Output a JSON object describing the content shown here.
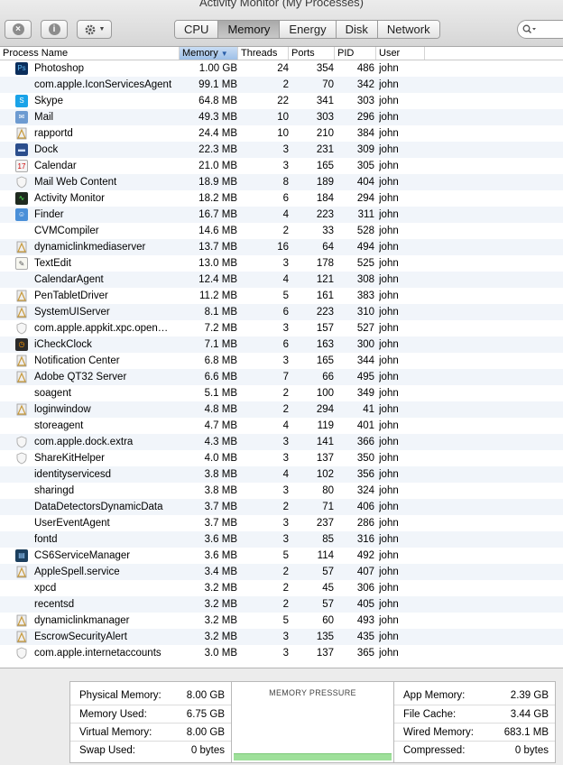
{
  "window": {
    "title": "Activity Monitor (My Processes)"
  },
  "toolbar": {
    "stop_icon": "x-circle-icon",
    "info_icon": "info-circle-icon",
    "gear_icon": "gear-icon",
    "tabs": [
      {
        "label": "CPU",
        "active": false
      },
      {
        "label": "Memory",
        "active": true
      },
      {
        "label": "Energy",
        "active": false
      },
      {
        "label": "Disk",
        "active": false
      },
      {
        "label": "Network",
        "active": false
      }
    ],
    "search_icon": "magnifier-icon"
  },
  "table": {
    "columns": {
      "name": "Process Name",
      "memory": "Memory",
      "threads": "Threads",
      "ports": "Ports",
      "pid": "PID",
      "user": "User"
    },
    "sorted_column": "Memory",
    "rows": [
      {
        "name": "Photoshop",
        "memory": "1.00 GB",
        "threads": "24",
        "ports": "354",
        "pid": "486",
        "user": "john",
        "icon": "photoshop-icon"
      },
      {
        "name": "com.apple.IconServicesAgent",
        "memory": "99.1 MB",
        "threads": "2",
        "ports": "70",
        "pid": "342",
        "user": "john",
        "icon": ""
      },
      {
        "name": "Skype",
        "memory": "64.8 MB",
        "threads": "22",
        "ports": "341",
        "pid": "303",
        "user": "john",
        "icon": "skype-icon"
      },
      {
        "name": "Mail",
        "memory": "49.3 MB",
        "threads": "10",
        "ports": "303",
        "pid": "296",
        "user": "john",
        "icon": "mail-icon"
      },
      {
        "name": "rapportd",
        "memory": "24.4 MB",
        "threads": "10",
        "ports": "210",
        "pid": "384",
        "user": "john",
        "icon": "exec-icon"
      },
      {
        "name": "Dock",
        "memory": "22.3 MB",
        "threads": "3",
        "ports": "231",
        "pid": "309",
        "user": "john",
        "icon": "dock-icon"
      },
      {
        "name": "Calendar",
        "memory": "21.0 MB",
        "threads": "3",
        "ports": "165",
        "pid": "305",
        "user": "john",
        "icon": "calendar-icon"
      },
      {
        "name": "Mail Web Content",
        "memory": "18.9 MB",
        "threads": "8",
        "ports": "189",
        "pid": "404",
        "user": "john",
        "icon": "shield-icon"
      },
      {
        "name": "Activity Monitor",
        "memory": "18.2 MB",
        "threads": "6",
        "ports": "184",
        "pid": "294",
        "user": "john",
        "icon": "activity-monitor-icon"
      },
      {
        "name": "Finder",
        "memory": "16.7 MB",
        "threads": "4",
        "ports": "223",
        "pid": "311",
        "user": "john",
        "icon": "finder-icon"
      },
      {
        "name": "CVMCompiler",
        "memory": "14.6 MB",
        "threads": "2",
        "ports": "33",
        "pid": "528",
        "user": "john",
        "icon": ""
      },
      {
        "name": "dynamiclinkmediaserver",
        "memory": "13.7 MB",
        "threads": "16",
        "ports": "64",
        "pid": "494",
        "user": "john",
        "icon": "exec-icon"
      },
      {
        "name": "TextEdit",
        "memory": "13.0 MB",
        "threads": "3",
        "ports": "178",
        "pid": "525",
        "user": "john",
        "icon": "textedit-icon"
      },
      {
        "name": "CalendarAgent",
        "memory": "12.4 MB",
        "threads": "4",
        "ports": "121",
        "pid": "308",
        "user": "john",
        "icon": ""
      },
      {
        "name": "PenTabletDriver",
        "memory": "11.2 MB",
        "threads": "5",
        "ports": "161",
        "pid": "383",
        "user": "john",
        "icon": "exec-icon"
      },
      {
        "name": "SystemUIServer",
        "memory": "8.1 MB",
        "threads": "6",
        "ports": "223",
        "pid": "310",
        "user": "john",
        "icon": "exec-icon"
      },
      {
        "name": "com.apple.appkit.xpc.open…",
        "memory": "7.2 MB",
        "threads": "3",
        "ports": "157",
        "pid": "527",
        "user": "john",
        "icon": "shield-icon"
      },
      {
        "name": "iCheckClock",
        "memory": "7.1 MB",
        "threads": "6",
        "ports": "163",
        "pid": "300",
        "user": "john",
        "icon": "clock-app-icon"
      },
      {
        "name": "Notification Center",
        "memory": "6.8 MB",
        "threads": "3",
        "ports": "165",
        "pid": "344",
        "user": "john",
        "icon": "exec-icon"
      },
      {
        "name": "Adobe QT32 Server",
        "memory": "6.6 MB",
        "threads": "7",
        "ports": "66",
        "pid": "495",
        "user": "john",
        "icon": "exec-icon"
      },
      {
        "name": "soagent",
        "memory": "5.1 MB",
        "threads": "2",
        "ports": "100",
        "pid": "349",
        "user": "john",
        "icon": ""
      },
      {
        "name": "loginwindow",
        "memory": "4.8 MB",
        "threads": "2",
        "ports": "294",
        "pid": "41",
        "user": "john",
        "icon": "exec-icon"
      },
      {
        "name": "storeagent",
        "memory": "4.7 MB",
        "threads": "4",
        "ports": "119",
        "pid": "401",
        "user": "john",
        "icon": ""
      },
      {
        "name": "com.apple.dock.extra",
        "memory": "4.3 MB",
        "threads": "3",
        "ports": "141",
        "pid": "366",
        "user": "john",
        "icon": "shield-icon"
      },
      {
        "name": "ShareKitHelper",
        "memory": "4.0 MB",
        "threads": "3",
        "ports": "137",
        "pid": "350",
        "user": "john",
        "icon": "shield-icon"
      },
      {
        "name": "identityservicesd",
        "memory": "3.8 MB",
        "threads": "4",
        "ports": "102",
        "pid": "356",
        "user": "john",
        "icon": ""
      },
      {
        "name": "sharingd",
        "memory": "3.8 MB",
        "threads": "3",
        "ports": "80",
        "pid": "324",
        "user": "john",
        "icon": ""
      },
      {
        "name": "DataDetectorsDynamicData",
        "memory": "3.7 MB",
        "threads": "2",
        "ports": "71",
        "pid": "406",
        "user": "john",
        "icon": ""
      },
      {
        "name": "UserEventAgent",
        "memory": "3.7 MB",
        "threads": "3",
        "ports": "237",
        "pid": "286",
        "user": "john",
        "icon": ""
      },
      {
        "name": "fontd",
        "memory": "3.6 MB",
        "threads": "3",
        "ports": "85",
        "pid": "316",
        "user": "john",
        "icon": ""
      },
      {
        "name": "CS6ServiceManager",
        "memory": "3.6 MB",
        "threads": "5",
        "ports": "114",
        "pid": "492",
        "user": "john",
        "icon": "service-manager-icon"
      },
      {
        "name": "AppleSpell.service",
        "memory": "3.4 MB",
        "threads": "2",
        "ports": "57",
        "pid": "407",
        "user": "john",
        "icon": "exec-icon"
      },
      {
        "name": "xpcd",
        "memory": "3.2 MB",
        "threads": "2",
        "ports": "45",
        "pid": "306",
        "user": "john",
        "icon": ""
      },
      {
        "name": "recentsd",
        "memory": "3.2 MB",
        "threads": "2",
        "ports": "57",
        "pid": "405",
        "user": "john",
        "icon": ""
      },
      {
        "name": "dynamiclinkmanager",
        "memory": "3.2 MB",
        "threads": "5",
        "ports": "60",
        "pid": "493",
        "user": "john",
        "icon": "exec-icon"
      },
      {
        "name": "EscrowSecurityAlert",
        "memory": "3.2 MB",
        "threads": "3",
        "ports": "135",
        "pid": "435",
        "user": "john",
        "icon": "exec-icon"
      },
      {
        "name": "com.apple.internetaccounts",
        "memory": "3.0 MB",
        "threads": "3",
        "ports": "137",
        "pid": "365",
        "user": "john",
        "icon": "shield-icon"
      }
    ]
  },
  "summary": {
    "left": [
      {
        "label": "Physical Memory:",
        "value": "8.00 GB"
      },
      {
        "label": "Memory Used:",
        "value": "6.75 GB"
      },
      {
        "label": "Virtual Memory:",
        "value": "8.00 GB"
      },
      {
        "label": "Swap Used:",
        "value": "0 bytes"
      }
    ],
    "pressure_title": "MEMORY PRESSURE",
    "pressure_color": "#9ee09a",
    "right": [
      {
        "label": "App Memory:",
        "value": "2.39 GB"
      },
      {
        "label": "File Cache:",
        "value": "3.44 GB"
      },
      {
        "label": "Wired Memory:",
        "value": "683.1 MB"
      },
      {
        "label": "Compressed:",
        "value": "0 bytes"
      }
    ]
  }
}
